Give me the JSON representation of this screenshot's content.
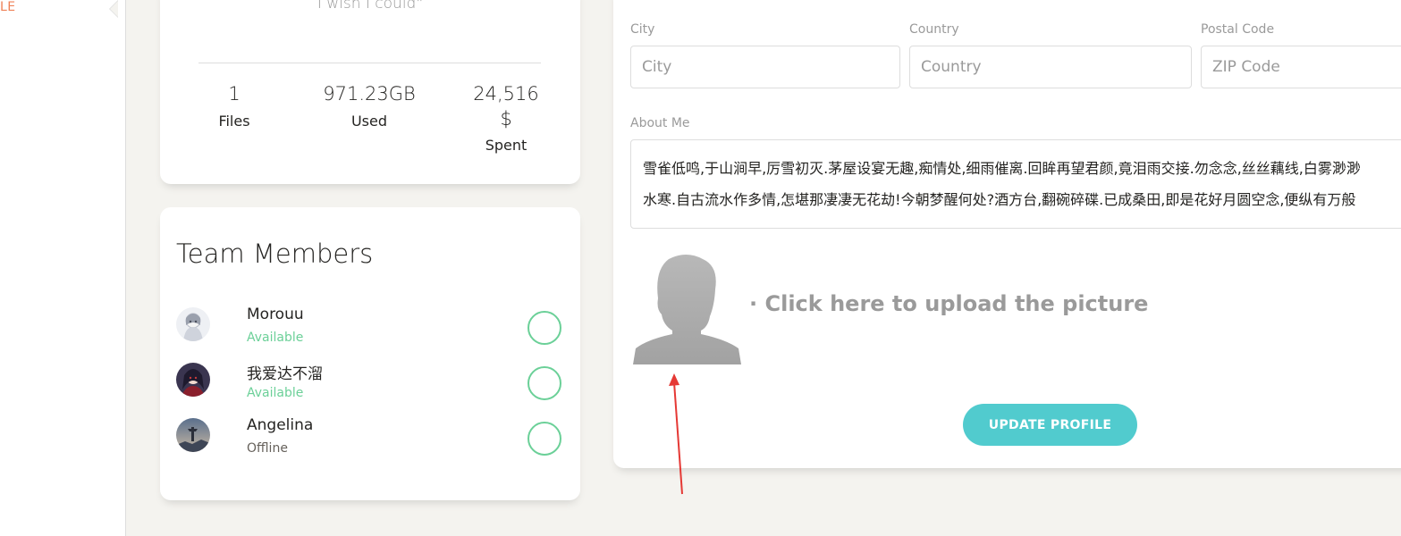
{
  "sidebar": {
    "active_label": "LE"
  },
  "user_card": {
    "quote": "I wish I could\"",
    "stats": [
      {
        "value": "1",
        "label": "Files"
      },
      {
        "value": "971.23GB",
        "label": "Used"
      },
      {
        "value": "24,516",
        "unit": "$",
        "label": "Spent"
      }
    ]
  },
  "team": {
    "title": "Team Members",
    "members": [
      {
        "name": "Morouu",
        "status": "Available"
      },
      {
        "name": "我爱达不溜",
        "status": "Available"
      },
      {
        "name": "Angelina",
        "status": "Offline"
      }
    ]
  },
  "form": {
    "city": {
      "label": "City",
      "placeholder": "City"
    },
    "country": {
      "label": "Country",
      "placeholder": "Country"
    },
    "postal": {
      "label": "Postal Code",
      "placeholder": "ZIP Code"
    },
    "about": {
      "label": "About Me",
      "line1": "雪雀低鸣,于山涧早,厉雪初灭.茅屋设宴无趣,痴情处,细雨催离.回眸再望君颜,竟泪雨交接.勿念念,丝丝藕线,白雾渺渺",
      "line2": "水寒.自古流水作多情,怎堪那凄凄无花劫!今朝梦醒何处?酒方台,翻碗碎碟.已成桑田,即是花好月圆空念,便纵有万般"
    },
    "upload_text": "· Click here to upload the picture",
    "update_button": "UPDATE PROFILE"
  },
  "colors": {
    "accent_orange": "#ef8157",
    "available_green": "#6bd098",
    "primary_teal": "#51cbce",
    "muted_gray": "#9a9a9a",
    "background": "#f4f3ef",
    "annotation_red": "#e53935"
  },
  "icons": [
    "user-silhouette-icon",
    "avatar-image",
    "annotation-arrow-icon"
  ]
}
